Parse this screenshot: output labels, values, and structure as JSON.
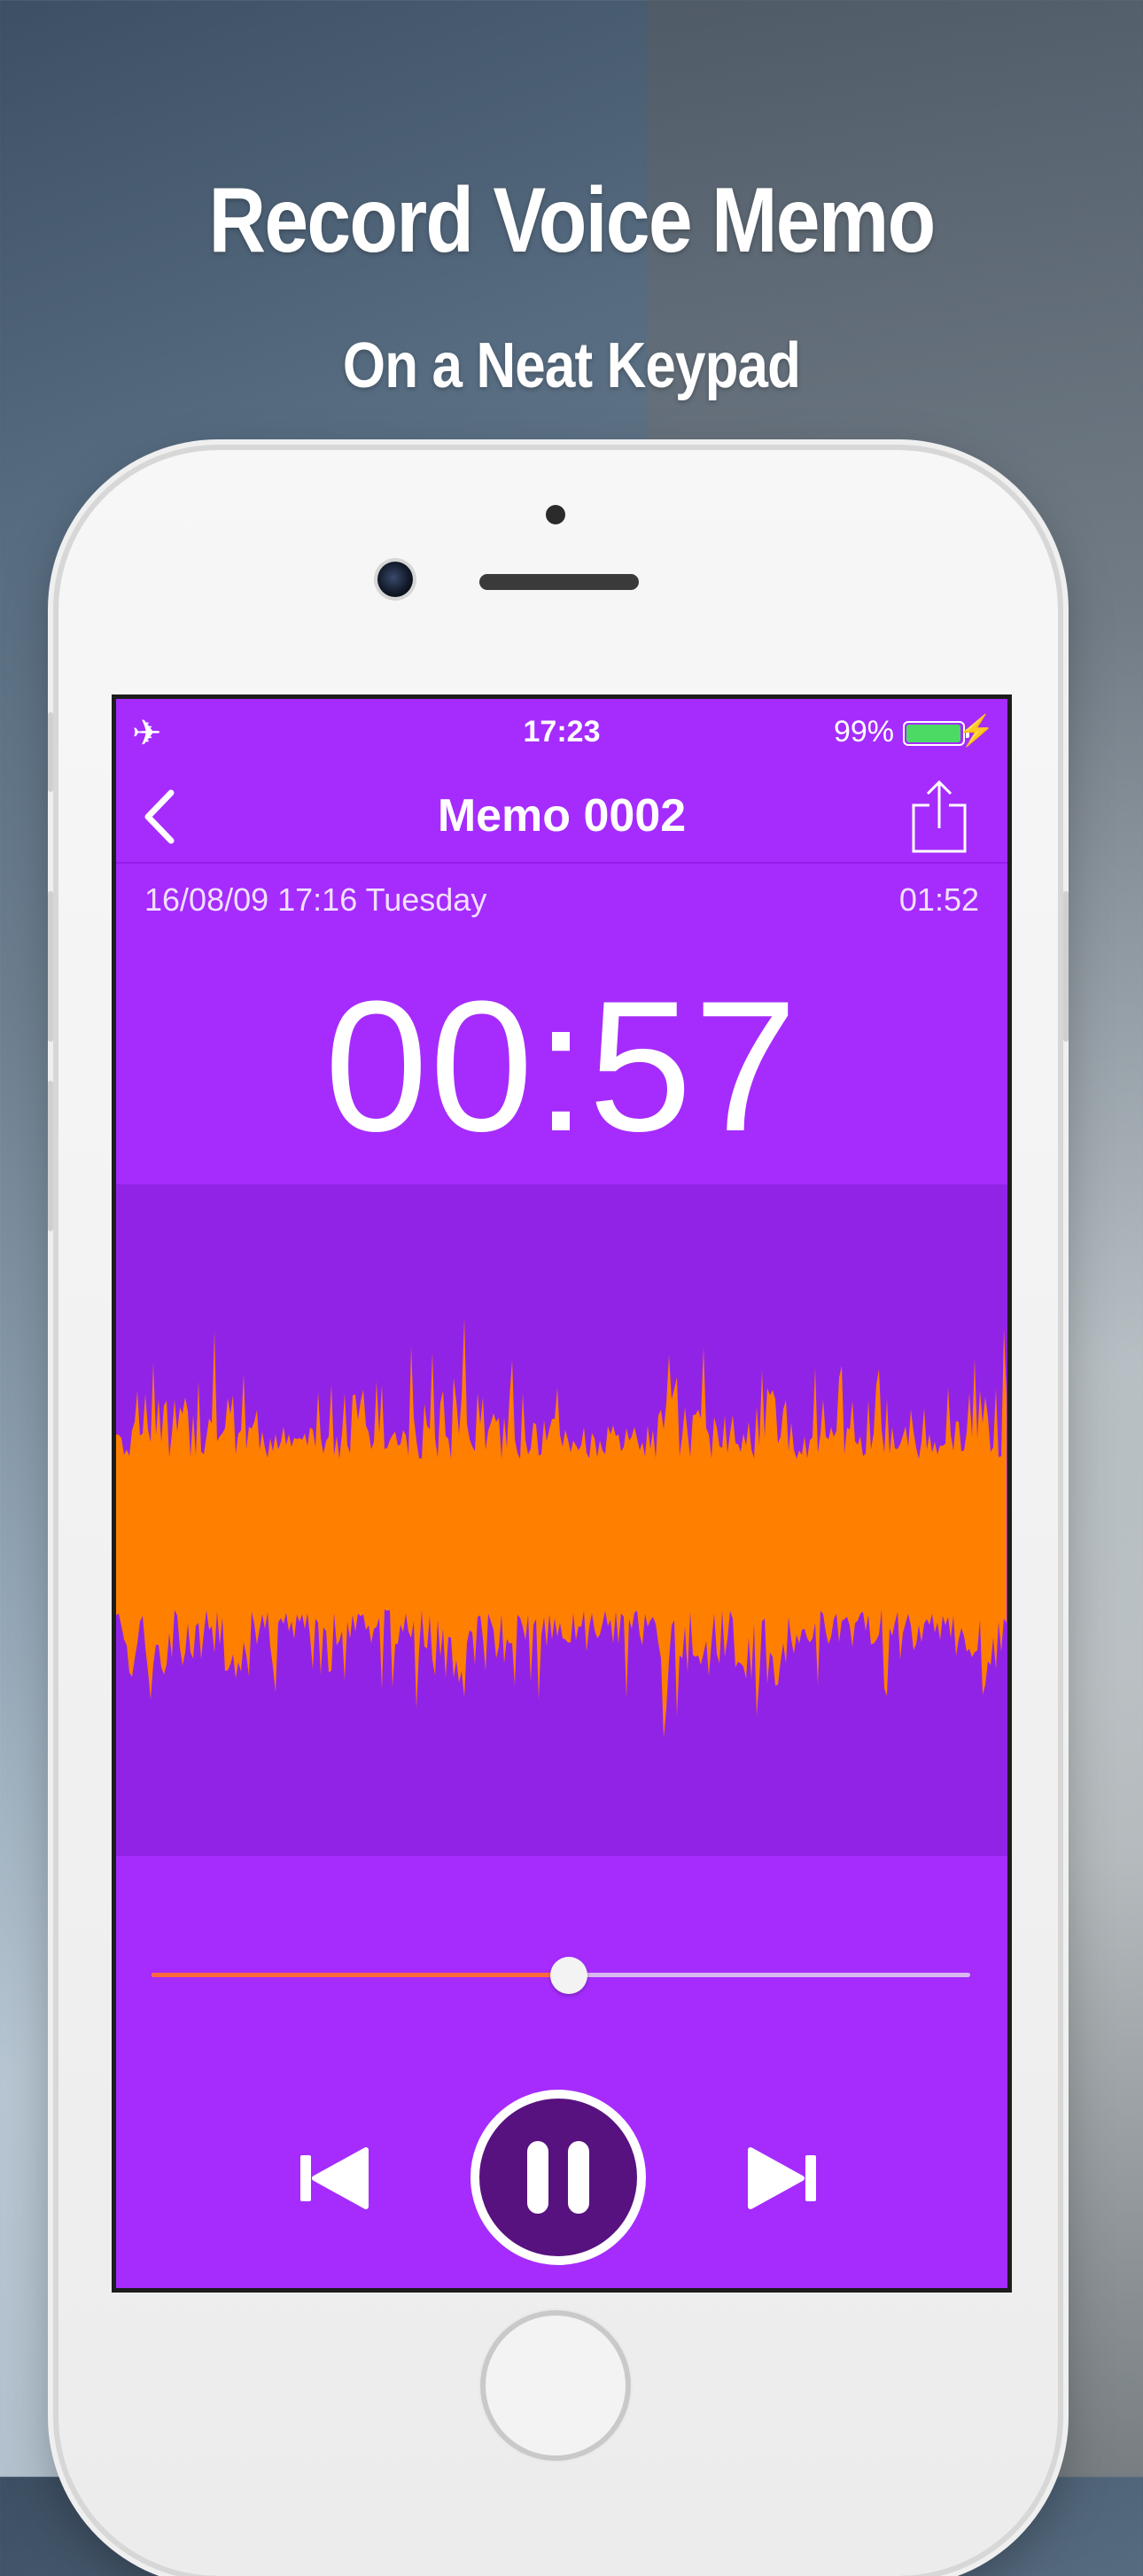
{
  "promo": {
    "headline": "Record Voice Memo",
    "subline": "On a Neat Keypad"
  },
  "status_bar": {
    "airplane_icon": "airplane-icon",
    "time": "17:23",
    "battery_percent": "99%",
    "battery_level": 0.99,
    "charging_icon": "bolt-icon"
  },
  "navbar": {
    "back_icon": "chevron-left-icon",
    "title": "Memo 0002",
    "share_icon": "share-icon"
  },
  "memo": {
    "date": "16/08/09 17:16 Tuesday",
    "duration": "01:52",
    "elapsed": "00:57"
  },
  "playback": {
    "progress": 0.51,
    "rewind_icon": "skip-back-icon",
    "pause_icon": "pause-icon",
    "forward_icon": "skip-forward-icon"
  },
  "colors": {
    "screen_bg": "#a52cfd",
    "wave_bg": "#9123e6",
    "waveform": "#ff7f00",
    "progress": "#ff6a3d",
    "pause_button": "#57127f",
    "battery": "#4cd964"
  }
}
